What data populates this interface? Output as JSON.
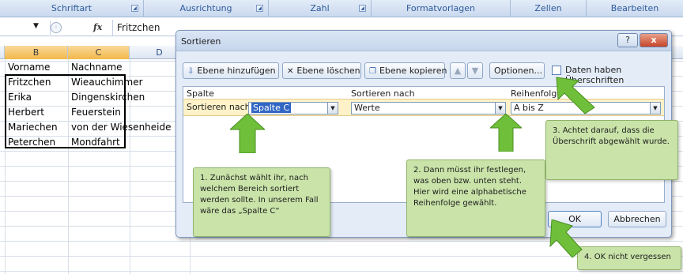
{
  "ribbon": {
    "groups": [
      {
        "label": "Schriftart"
      },
      {
        "label": "Ausrichtung"
      },
      {
        "label": "Zahl"
      },
      {
        "label": "Formatvorlagen"
      },
      {
        "label": "Zellen"
      },
      {
        "label": "Bearbeiten"
      }
    ],
    "launcher_icon": "dialog-launcher-icon"
  },
  "formula_bar": {
    "fx_label": "fx",
    "value": "Fritzchen"
  },
  "sheet": {
    "columns": [
      "B",
      "C",
      "D"
    ],
    "header_row": {
      "vorname": "Vorname",
      "nachname": "Nachname"
    },
    "rows": [
      {
        "vorname": "Fritzchen",
        "nachname": "Wieauchimmer"
      },
      {
        "vorname": "Erika",
        "nachname": "Dingenskirchen"
      },
      {
        "vorname": "Herbert",
        "nachname": "Feuerstein"
      },
      {
        "vorname": "Mariechen",
        "nachname": "von der Wiesenheide"
      },
      {
        "vorname": "Peterchen",
        "nachname": "Mondfahrt"
      }
    ]
  },
  "dialog": {
    "title": "Sortieren",
    "help_label": "?",
    "close_label": "x",
    "toolbar": {
      "add_level": "Ebene hinzufügen",
      "delete_level": "Ebene löschen",
      "copy_level": "Ebene kopieren",
      "move_up": "▲",
      "move_down": "▼",
      "options": "Optionen...",
      "headers_checkbox": "Daten haben Überschriften"
    },
    "grid": {
      "col_spalte": "Spalte",
      "col_sortieren_nach": "Sortieren nach",
      "col_reihenfolge": "Reihenfolge",
      "row_label": "Sortieren nach",
      "column_value": "Spalte C",
      "sort_on_value": "Werte",
      "order_value": "A bis Z"
    },
    "ok_label": "OK",
    "cancel_label": "Abbrechen"
  },
  "callouts": {
    "c1": "1. Zunächst wählt ihr, nach welchem Bereich sortiert werden sollte. In unserem Fall wäre das „Spalte C“",
    "c2": "2. Dann müsst ihr festlegen, was oben bzw. unten steht. Hier wird eine alphabetische Reihenfolge gewählt.",
    "c3": "3. Achtet darauf, dass die Überschrift abgewählt wurde.",
    "c4": "4. OK nicht vergessen"
  },
  "colors": {
    "callout_bg": "#c9e3a9",
    "arrow_fill": "#6fbf3a",
    "selection_blue": "#3166c4",
    "active_row": "#fff2c9"
  }
}
